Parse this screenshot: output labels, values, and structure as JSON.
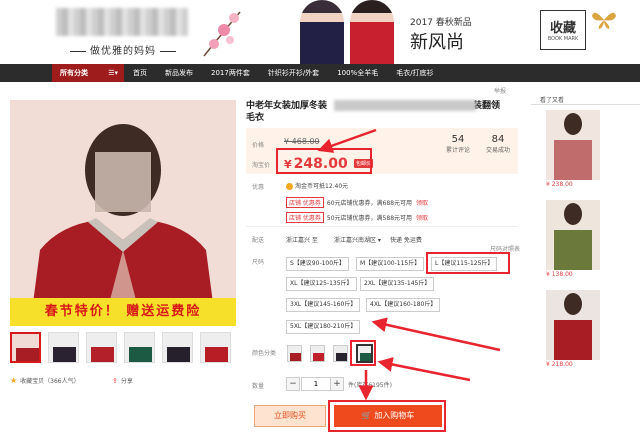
{
  "banner": {
    "slogan": "做优雅的妈妈",
    "season_tag": "2017 春秋新品",
    "season_title": "新风尚",
    "favorite_label": "收藏",
    "favorite_sub": "BOOK MARK"
  },
  "nav": {
    "all_categories": "所有分类",
    "items": [
      "首页",
      "新品发布",
      "2017两件套",
      "针织衫开衫/外套",
      "100%全羊毛",
      "毛衣/打底衫"
    ]
  },
  "report_label": "举报",
  "product": {
    "title_prefix": "中老年女装加厚冬装",
    "title_suffix": "装翻领",
    "title_line2": "毛衣",
    "promo_banner": "春节特价！  赠送运费险",
    "price_label": "价格",
    "original_price": "¥ 468.00",
    "taobao_price_label": "淘宝价",
    "currency": "¥",
    "current_price": "248.00",
    "cheap_tag": "包邮价",
    "reviews_count": "54",
    "reviews_label": "累计评论",
    "sales_count": "84",
    "sales_label": "交易成功",
    "promo_label": "优惠",
    "coin_text": "淘金币可抵12.40元",
    "coupon_tag_1": "店铺 优惠券",
    "coupon_1_text": "60元店铺优惠券，满688元可用",
    "coupon_tag_2": "店铺 优惠券",
    "coupon_2_text": "50元店铺优惠券，满588元可用",
    "get_label": "领取",
    "delivery_label": "配送",
    "delivery_from": "浙江嘉兴 至",
    "delivery_to": "浙江嘉兴南湖区 ▾",
    "delivery_fee": "快递 免运费",
    "size_label": "尺码",
    "size_guide": "尺码对照表",
    "sizes": [
      "S【建议90-100斤】",
      "M【建议100-115斤】",
      "L【建议115-125斤】",
      "XL【建议125-135斤】",
      "2XL【建议135-145斤】",
      "3XL【建议145-160斤】",
      "4XL【建议160-180斤】",
      "5XL【建议180-210斤】"
    ],
    "color_label": "颜色分类",
    "quantity_label": "数量",
    "quantity_value": "1",
    "quantity_minus": "−",
    "quantity_plus": "+",
    "stock_text": "件(库存6195件)",
    "buy_now": "立即购买",
    "add_to_cart": "加入购物车",
    "favorite_item": "收藏宝贝（366人气）",
    "share": "分享"
  },
  "sidebar": {
    "title": "看了又看",
    "prices": [
      "¥ 238.00",
      "¥ 138.00",
      "¥ 218.00"
    ]
  },
  "colors": {
    "accent": "#e4393c",
    "nav_bg": "#2c2c2c",
    "annotation": "#e8242e"
  }
}
